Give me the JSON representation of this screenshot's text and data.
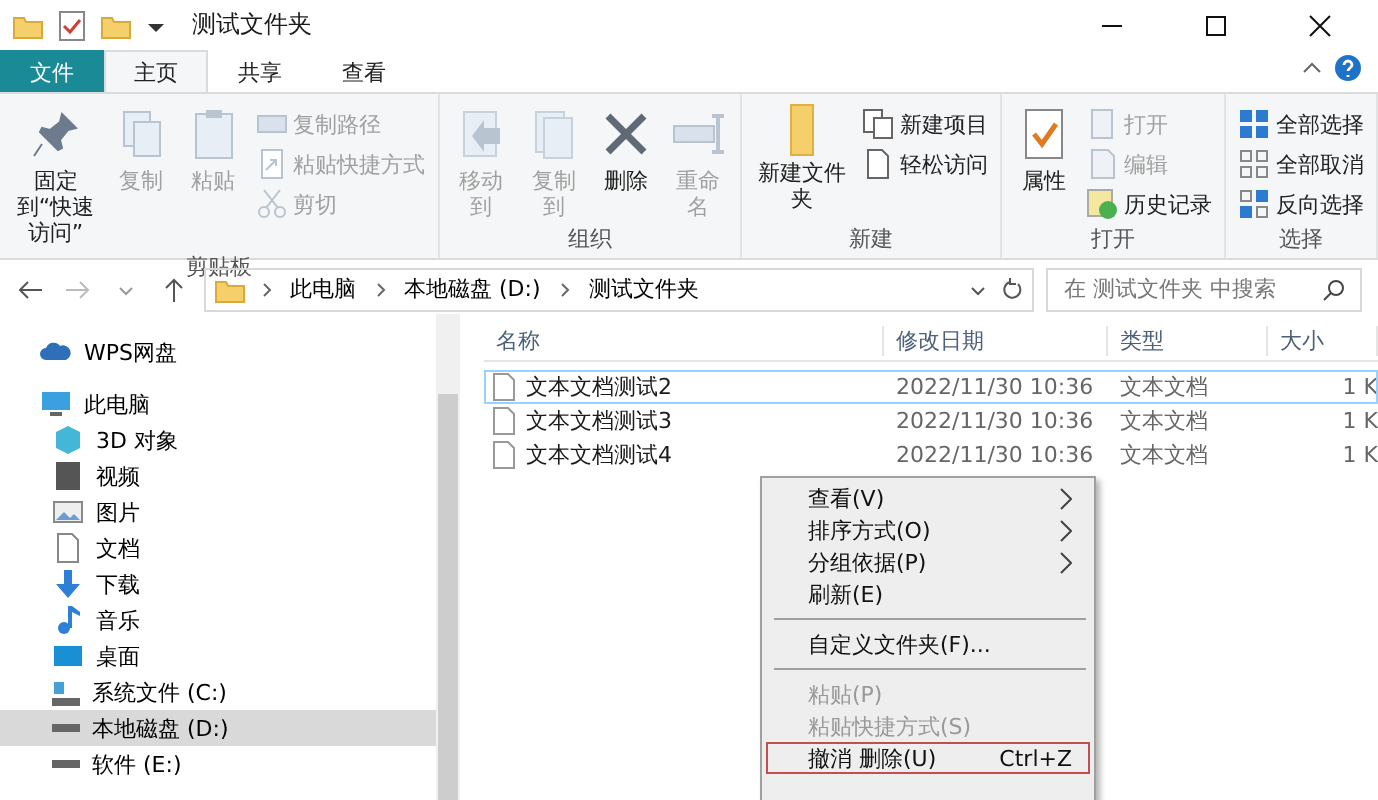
{
  "window": {
    "title": "测试文件夹"
  },
  "ribbon_tabs": [
    {
      "label": "文件",
      "kind": "file",
      "selected": false
    },
    {
      "label": "主页",
      "kind": "tab",
      "selected": true
    },
    {
      "label": "共享",
      "kind": "tab",
      "selected": false
    },
    {
      "label": "查看",
      "kind": "tab",
      "selected": false
    }
  ],
  "ribbon_groups": [
    {
      "label": "剪贴板",
      "items": [
        {
          "label": "固定到“快速访问”",
          "kind": "large",
          "disabled": false
        },
        {
          "label": "复制",
          "kind": "large",
          "disabled": true
        },
        {
          "label": "粘贴",
          "kind": "large",
          "disabled": true
        },
        {
          "label": "复制路径",
          "kind": "small",
          "disabled": true
        },
        {
          "label": "粘贴快捷方式",
          "kind": "small",
          "disabled": true
        },
        {
          "label": "剪切",
          "kind": "small",
          "disabled": true
        }
      ]
    },
    {
      "label": "组织",
      "items": [
        {
          "label": "移动到",
          "kind": "large",
          "disabled": true
        },
        {
          "label": "复制到",
          "kind": "large",
          "disabled": true
        },
        {
          "label": "删除",
          "kind": "large",
          "disabled": false
        },
        {
          "label": "重命名",
          "kind": "large",
          "disabled": true
        }
      ]
    },
    {
      "label": "新建",
      "items": [
        {
          "label": "新建文件夹",
          "kind": "large",
          "disabled": false
        },
        {
          "label": "新建项目",
          "kind": "small",
          "disabled": false
        },
        {
          "label": "轻松访问",
          "kind": "small",
          "disabled": false
        }
      ]
    },
    {
      "label": "打开",
      "items": [
        {
          "label": "属性",
          "kind": "large",
          "disabled": false
        },
        {
          "label": "打开",
          "kind": "small",
          "disabled": true
        },
        {
          "label": "编辑",
          "kind": "small",
          "disabled": true
        },
        {
          "label": "历史记录",
          "kind": "small",
          "disabled": false
        }
      ]
    },
    {
      "label": "选择",
      "items": [
        {
          "label": "全部选择",
          "kind": "small",
          "disabled": false
        },
        {
          "label": "全部取消",
          "kind": "small",
          "disabled": false
        },
        {
          "label": "反向选择",
          "kind": "small",
          "disabled": false
        }
      ]
    }
  ],
  "address": {
    "breadcrumb": [
      "此电脑",
      "本地磁盘 (D:)",
      "测试文件夹"
    ]
  },
  "search": {
    "placeholder": "在 测试文件夹 中搜索"
  },
  "sidebar": {
    "items": [
      {
        "label": "WPS网盘",
        "selected": false
      },
      {
        "label": "此电脑",
        "selected": false,
        "children": [
          {
            "label": "3D 对象",
            "selected": false
          },
          {
            "label": "视频",
            "selected": false
          },
          {
            "label": "图片",
            "selected": false
          },
          {
            "label": "文档",
            "selected": false
          },
          {
            "label": "下载",
            "selected": false
          },
          {
            "label": "音乐",
            "selected": false
          },
          {
            "label": "桌面",
            "selected": false
          },
          {
            "label": "系统文件 (C:)",
            "selected": false
          },
          {
            "label": "本地磁盘 (D:)",
            "selected": true
          },
          {
            "label": "软件 (E:)",
            "selected": false
          }
        ]
      }
    ]
  },
  "table": {
    "columns": [
      "名称",
      "修改日期",
      "类型",
      "大小"
    ],
    "rows": [
      {
        "name": "文本文档测试2",
        "modified": "2022/11/30 10:36",
        "type": "文本文档",
        "size": "1 K",
        "selected": true
      },
      {
        "name": "文本文档测试3",
        "modified": "2022/11/30 10:36",
        "type": "文本文档",
        "size": "1 K",
        "selected": false
      },
      {
        "name": "文本文档测试4",
        "modified": "2022/11/30 10:36",
        "type": "文本文档",
        "size": "1 K",
        "selected": false
      }
    ]
  },
  "context_menu": {
    "items": [
      {
        "kind": "item",
        "label": "查看(V)",
        "submenu": true,
        "disabled": false,
        "highlighted": false
      },
      {
        "kind": "item",
        "label": "排序方式(O)",
        "submenu": true,
        "disabled": false,
        "highlighted": false
      },
      {
        "kind": "item",
        "label": "分组依据(P)",
        "submenu": true,
        "disabled": false,
        "highlighted": false
      },
      {
        "kind": "item",
        "label": "刷新(E)",
        "submenu": false,
        "disabled": false,
        "highlighted": false
      },
      {
        "kind": "separator"
      },
      {
        "kind": "item",
        "label": "自定义文件夹(F)...",
        "submenu": false,
        "disabled": false,
        "highlighted": false
      },
      {
        "kind": "separator"
      },
      {
        "kind": "item",
        "label": "粘贴(P)",
        "submenu": false,
        "disabled": true,
        "highlighted": false
      },
      {
        "kind": "item",
        "label": "粘贴快捷方式(S)",
        "submenu": false,
        "disabled": true,
        "highlighted": false
      },
      {
        "kind": "item",
        "label": "撤消 删除(U)",
        "shortcut": "Ctrl+Z",
        "submenu": false,
        "disabled": false,
        "highlighted": true
      }
    ]
  }
}
